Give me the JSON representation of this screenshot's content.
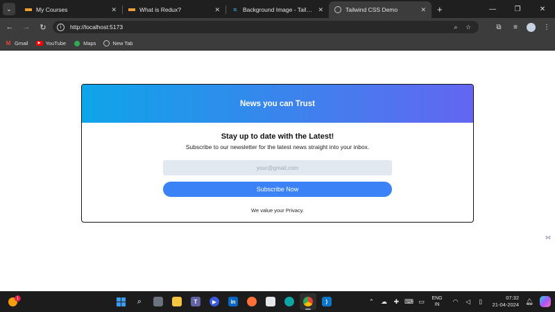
{
  "browser": {
    "tabs": [
      {
        "title": "My Courses",
        "favicon": "stacked-lines-icon",
        "active": false
      },
      {
        "title": "What is Redux?",
        "favicon": "stacked-lines-icon",
        "active": false
      },
      {
        "title": "Background Image - Tailwind CSS",
        "favicon": "tailwind-icon",
        "active": false
      },
      {
        "title": "Tailwind CSS Demo",
        "favicon": "globe-icon",
        "active": true
      }
    ],
    "url": "http://localhost:5173",
    "bookmarks": [
      {
        "label": "Gmail",
        "icon": "gmail-icon"
      },
      {
        "label": "YouTube",
        "icon": "youtube-icon"
      },
      {
        "label": "Maps",
        "icon": "maps-icon"
      },
      {
        "label": "New Tab",
        "icon": "globe-icon"
      }
    ]
  },
  "card": {
    "header_title": "News you can Trust",
    "heading": "Stay up to date with the Latest!",
    "subheading": "Subscribe to our newsletter for the latest news straight into your inbox.",
    "email_placeholder": "your@gmail.com",
    "email_value": "",
    "button_label": "Subscribe Now",
    "footer_note": "We value your Privacy.",
    "colors": {
      "gradient_start": "#0ea5e9",
      "gradient_end": "#6366f1",
      "button": "#3b82f6",
      "input_bg": "#e2e8f0"
    }
  },
  "taskbar": {
    "weather_badge": "1",
    "apps": [
      "start-icon",
      "search-icon",
      "task-view-icon",
      "file-explorer-icon",
      "teams-icon",
      "media-player-icon",
      "linkedin-icon",
      "firefox-icon",
      "microsoft-store-icon",
      "edge-icon",
      "chrome-icon",
      "vscode-icon"
    ],
    "language": "ENG",
    "region": "IN",
    "time": "07:32",
    "date": "21-04-2024"
  }
}
